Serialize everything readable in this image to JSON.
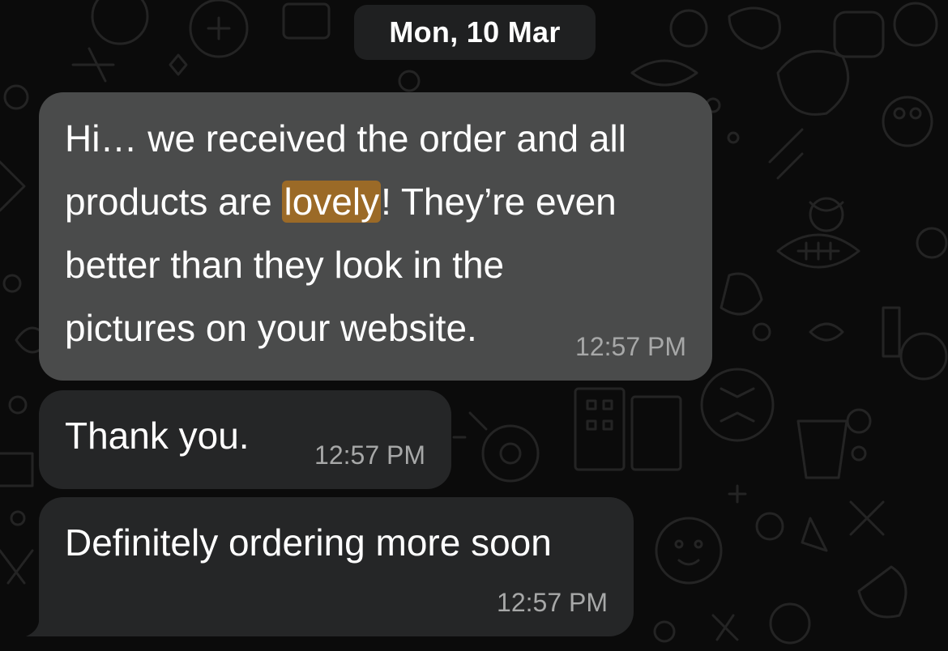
{
  "date_separator": "Mon, 10 Mar",
  "messages": [
    {
      "lines": [
        "Hi… we received the order and all",
        "products are ",
        "! They’re even",
        "better than they look in the",
        "pictures on your website."
      ],
      "highlighted_word": "lovely",
      "time": "12:57 PM"
    },
    {
      "text": "Thank you.",
      "time": "12:57 PM"
    },
    {
      "text": "Definitely ordering more soon",
      "time": "12:57 PM"
    }
  ],
  "colors": {
    "background": "#0b0b0b",
    "date_chip": "#1f2021",
    "highlighted_bubble": "#4a4b4b",
    "incoming_bubble": "#252627",
    "highlight": "#9b6a27",
    "timestamp": "#a7a8a8"
  }
}
